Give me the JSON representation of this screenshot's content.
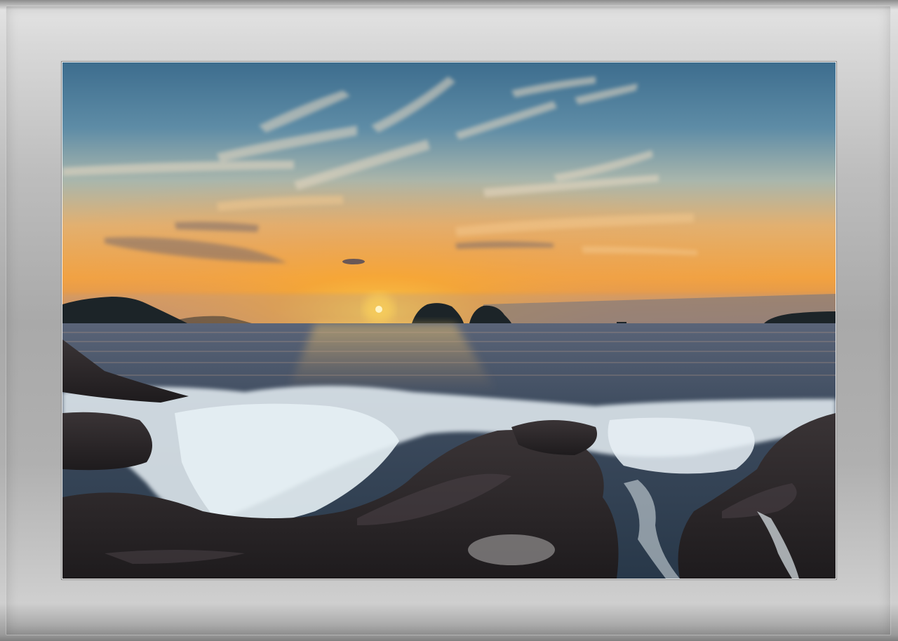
{
  "scene": {
    "description_tag": "sunset-seascape",
    "colors": {
      "sky_top": "#3f7090",
      "sky_mid": "#9fb2ad",
      "sky_glow": "#f0b14a",
      "sun": "#fff2b0",
      "sea": "#37475a",
      "rock": "#242022",
      "foam": "#e8f2f7",
      "frame": "#bdbdbd"
    }
  }
}
